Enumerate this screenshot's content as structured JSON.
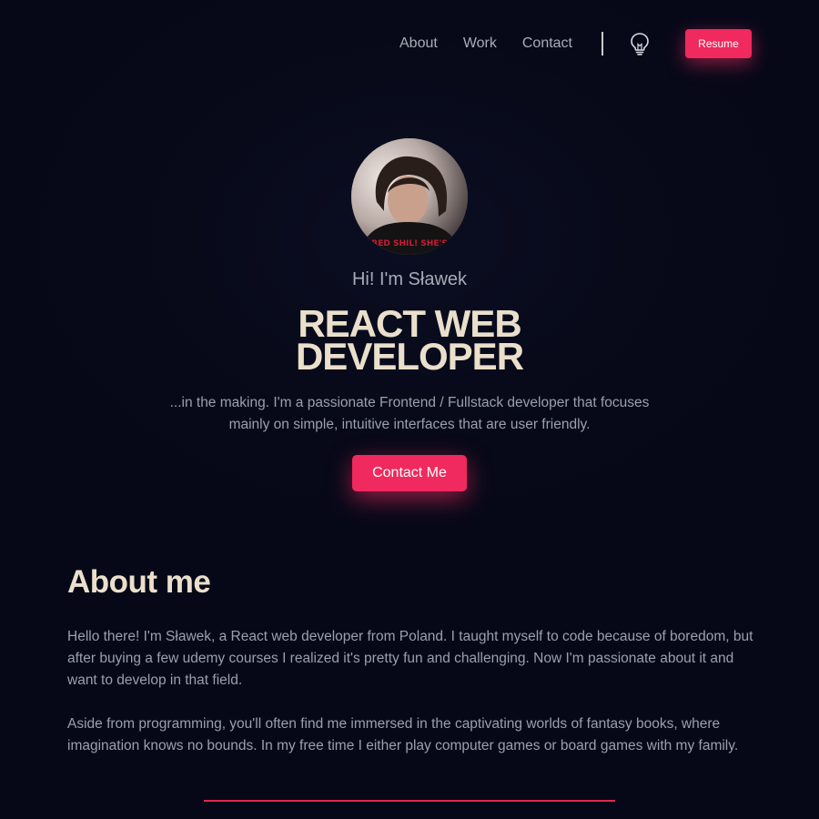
{
  "nav": {
    "links": [
      "About",
      "Work",
      "Contact"
    ],
    "theme_icon": "lightbulb-icon",
    "resume_label": "Resume"
  },
  "hero": {
    "greeting": "Hi! I'm Sławek",
    "headline_line1": "REACT WEB",
    "headline_line2": "DEVELOPER",
    "intro": "...in the making. I'm a passionate Frontend / Fullstack developer that focuses mainly on simple, intuitive interfaces that are user friendly.",
    "cta_label": "Contact Me",
    "avatar_shirt_text": "RED SHIL! SHE'S"
  },
  "about": {
    "title": "About me",
    "paragraph1": "Hello there! I'm Sławek, a React web developer from Poland. I taught myself to code because of boredom, but after buying a few udemy courses I realized it's pretty fun and challenging. Now I'm passionate about it and want to develop in that field.",
    "paragraph2": "Aside from programming, you'll often find me immersed in the captivating worlds of fantasy books, where imagination knows no bounds. In my free time I either play computer games or board games with my family."
  },
  "colors": {
    "background": "#060818",
    "accent": "#f0295e",
    "heading": "#eadfcb",
    "body_text": "#9aa0ac"
  }
}
